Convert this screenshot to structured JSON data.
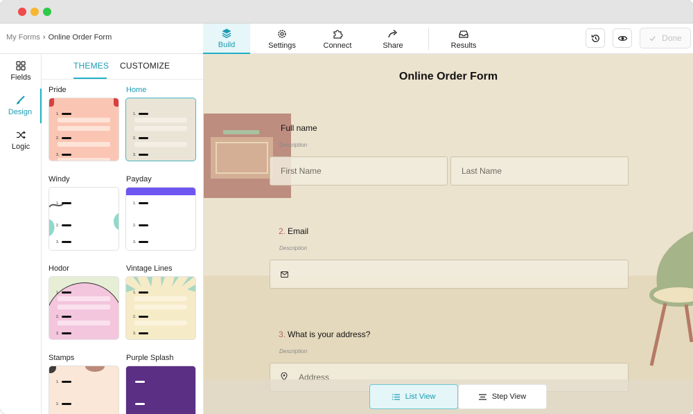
{
  "breadcrumb": {
    "root": "My Forms",
    "separator": "›",
    "current": "Online Order Form"
  },
  "nav_tabs": [
    {
      "label": "Build",
      "icon": "layers-icon",
      "active": true
    },
    {
      "label": "Settings",
      "icon": "gear-icon",
      "active": false
    },
    {
      "label": "Connect",
      "icon": "puzzle-icon",
      "active": false
    },
    {
      "label": "Share",
      "icon": "share-arrow-icon",
      "active": false
    },
    {
      "label": "Results",
      "icon": "inbox-icon",
      "active": false
    }
  ],
  "toolbar": {
    "done_label": "Done"
  },
  "rail": [
    {
      "label": "Fields",
      "icon": "grid-icon"
    },
    {
      "label": "Design",
      "icon": "brush-icon",
      "active": true
    },
    {
      "label": "Logic",
      "icon": "shuffle-icon"
    }
  ],
  "panel": {
    "tabs": [
      {
        "label": "THEMES",
        "active": true
      },
      {
        "label": "CUSTOMIZE",
        "active": false
      }
    ],
    "themes": [
      {
        "name": "Pride",
        "colors": {
          "bg": "#fbc5b3",
          "field": "#fde3d8",
          "accent": "#d84040"
        }
      },
      {
        "name": "Home",
        "selected": true,
        "colors": {
          "bg": "#e9e4d6",
          "field": "#f3efe4"
        }
      },
      {
        "name": "Windy",
        "colors": {
          "bg": "#ffffff",
          "accent": "#8fd9cb"
        }
      },
      {
        "name": "Payday",
        "colors": {
          "bg": "#ffffff",
          "accent": "#6e56f0"
        }
      },
      {
        "name": "Hodor",
        "colors": {
          "bg": "#f3c6dd",
          "field": "#fbe1ee",
          "accent": "#e6efd5"
        }
      },
      {
        "name": "Vintage Lines",
        "colors": {
          "bg": "#f6ebc7",
          "field": "#fbf3dc",
          "accent": "#a9d7c4"
        }
      },
      {
        "name": "Stamps",
        "colors": {
          "bg": "#fbe7d8",
          "accent": "#3d3d3d"
        }
      },
      {
        "name": "Purple Splash",
        "colors": {
          "bg": "#5b2f84",
          "accent": "#ffffff"
        }
      }
    ]
  },
  "form": {
    "title": "Online Order Form",
    "questions": [
      {
        "number": "",
        "label": "Full name",
        "description": "Description",
        "inputs": [
          {
            "placeholder": "First Name"
          },
          {
            "placeholder": "Last Name"
          }
        ]
      },
      {
        "number": "2.",
        "label": "Email",
        "description": "Description",
        "icon": "envelope-icon"
      },
      {
        "number": "3.",
        "label": "What is your address?",
        "description": "Description",
        "inputs": [
          {
            "placeholder": "Address",
            "icon": "location-pin-icon"
          }
        ]
      }
    ]
  },
  "view_toggle": {
    "list_label": "List View",
    "step_label": "Step View",
    "active": "list"
  },
  "colors": {
    "accent": "#1fb0c6",
    "canvas_bg": "#ece3cf"
  }
}
